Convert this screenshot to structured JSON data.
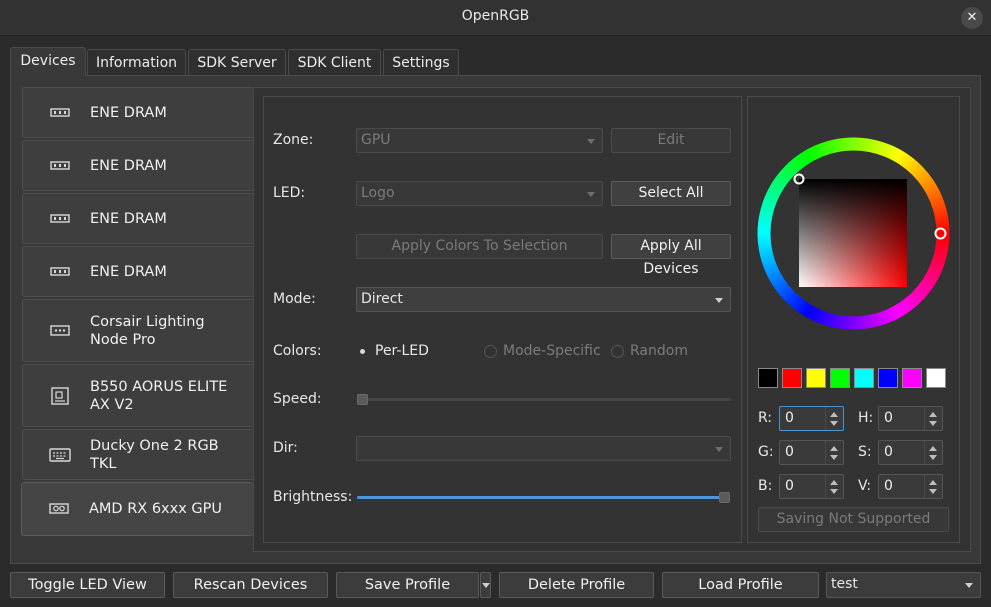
{
  "window": {
    "title": "OpenRGB",
    "close_glyph": "✕"
  },
  "tabs": [
    {
      "label": "Devices",
      "active": true
    },
    {
      "label": "Information"
    },
    {
      "label": "SDK Server"
    },
    {
      "label": "SDK Client"
    },
    {
      "label": "Settings"
    }
  ],
  "devices": [
    {
      "label": "ENE DRAM",
      "icon": "ram-icon"
    },
    {
      "label": "ENE DRAM",
      "icon": "ram-icon"
    },
    {
      "label": "ENE DRAM",
      "icon": "ram-icon"
    },
    {
      "label": "ENE DRAM",
      "icon": "ram-icon"
    },
    {
      "label": "Corsair Lighting Node Pro",
      "icon": "controller-icon"
    },
    {
      "label": "B550 AORUS ELITE AX V2",
      "icon": "motherboard-icon"
    },
    {
      "label": "Ducky One 2 RGB TKL",
      "icon": "keyboard-icon"
    },
    {
      "label": "AMD RX 6xxx GPU",
      "icon": "gpu-icon",
      "selected": true
    }
  ],
  "controls": {
    "zone_label": "Zone:",
    "zone_value": "GPU",
    "edit_label": "Edit",
    "led_label": "LED:",
    "led_value": "Logo",
    "select_all_label": "Select All",
    "apply_selection_label": "Apply Colors To Selection",
    "apply_all_label": "Apply All Devices",
    "mode_label": "Mode:",
    "mode_value": "Direct",
    "colors_label": "Colors:",
    "color_modes": [
      "Per-LED",
      "Mode-Specific",
      "Random"
    ],
    "color_mode_selected": "Per-LED",
    "speed_label": "Speed:",
    "speed_value": 0,
    "dir_label": "Dir:",
    "dir_value": "",
    "brightness_label": "Brightness:",
    "brightness_value": 1.0
  },
  "color_picker": {
    "swatches": [
      "#000000",
      "#ff0000",
      "#ffff00",
      "#00ff00",
      "#00ffff",
      "#0000ff",
      "#ff00ff",
      "#ffffff"
    ],
    "R": {
      "label": "R:",
      "value": "0"
    },
    "G": {
      "label": "G:",
      "value": "0"
    },
    "B": {
      "label": "B:",
      "value": "0"
    },
    "H": {
      "label": "H:",
      "value": "0"
    },
    "S": {
      "label": "S:",
      "value": "0"
    },
    "V": {
      "label": "V:",
      "value": "0"
    },
    "save_label": "Saving Not Supported"
  },
  "toolbar": {
    "toggle_led_view": "Toggle LED View",
    "rescan_devices": "Rescan Devices",
    "save_profile": "Save Profile",
    "delete_profile": "Delete Profile",
    "load_profile": "Load Profile",
    "profile_value": "test"
  },
  "accent_color": "#4d93d8"
}
